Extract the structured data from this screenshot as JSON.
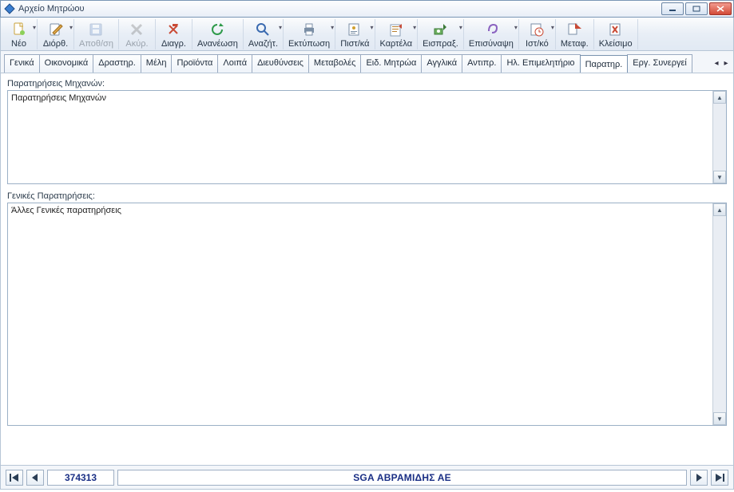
{
  "window": {
    "title": "Αρχείο Μητρώου"
  },
  "toolbar": {
    "items": [
      {
        "label": "Νέο",
        "icon": "new-doc",
        "disabled": false,
        "dropdown": true
      },
      {
        "label": "Διόρθ.",
        "icon": "edit",
        "disabled": false,
        "dropdown": true
      },
      {
        "label": "Αποθ/ση",
        "icon": "save",
        "disabled": true,
        "dropdown": false
      },
      {
        "label": "Ακύρ.",
        "icon": "cancel",
        "disabled": true,
        "dropdown": false
      },
      {
        "label": "Διαγρ.",
        "icon": "delete",
        "disabled": false,
        "dropdown": false
      },
      {
        "label": "Ανανέωση",
        "icon": "refresh",
        "disabled": false,
        "dropdown": false
      },
      {
        "label": "Αναζήτ.",
        "icon": "search",
        "disabled": false,
        "dropdown": true
      },
      {
        "label": "Εκτύπωση",
        "icon": "print",
        "disabled": false,
        "dropdown": true
      },
      {
        "label": "Πιστ/κά",
        "icon": "credentials",
        "disabled": false,
        "dropdown": true
      },
      {
        "label": "Καρτέλα",
        "icon": "card",
        "disabled": false,
        "dropdown": true
      },
      {
        "label": "Εισπραξ.",
        "icon": "money-in",
        "disabled": false,
        "dropdown": true
      },
      {
        "label": "Επισύναψη",
        "icon": "attach",
        "disabled": false,
        "dropdown": true
      },
      {
        "label": "Ιστ/κό",
        "icon": "history",
        "disabled": false,
        "dropdown": true
      },
      {
        "label": "Μεταφ.",
        "icon": "transfer",
        "disabled": false,
        "dropdown": false
      },
      {
        "label": "Κλείσιμο",
        "icon": "close-doc",
        "disabled": false,
        "dropdown": false
      }
    ]
  },
  "tabs": {
    "items": [
      "Γενικά",
      "Οικονομικά",
      "Δραστηρ.",
      "Μέλη",
      "Προϊόντα",
      "Λοιπά",
      "Διευθύνσεις",
      "Μεταβολές",
      "Ειδ. Μητρώα",
      "Αγγλικά",
      "Αντιπρ.",
      "Ηλ. Επιμελητήριο",
      "Παρατηρ.",
      "Εργ. Συνεργεί"
    ],
    "active_index": 12
  },
  "panels": {
    "machine_notes": {
      "label": "Παρατηρήσεις Μηχανών:",
      "text": "Παρατηρήσεις Μηχανών"
    },
    "general_notes": {
      "label": "Γενικές Παρατηρήσεις:",
      "text": "Άλλες Γενικές παρατηρήσεις"
    }
  },
  "footer": {
    "record_id": "374313",
    "record_name": "SGA ΑΒΡΑΜΙΔΗΣ ΑΕ"
  }
}
